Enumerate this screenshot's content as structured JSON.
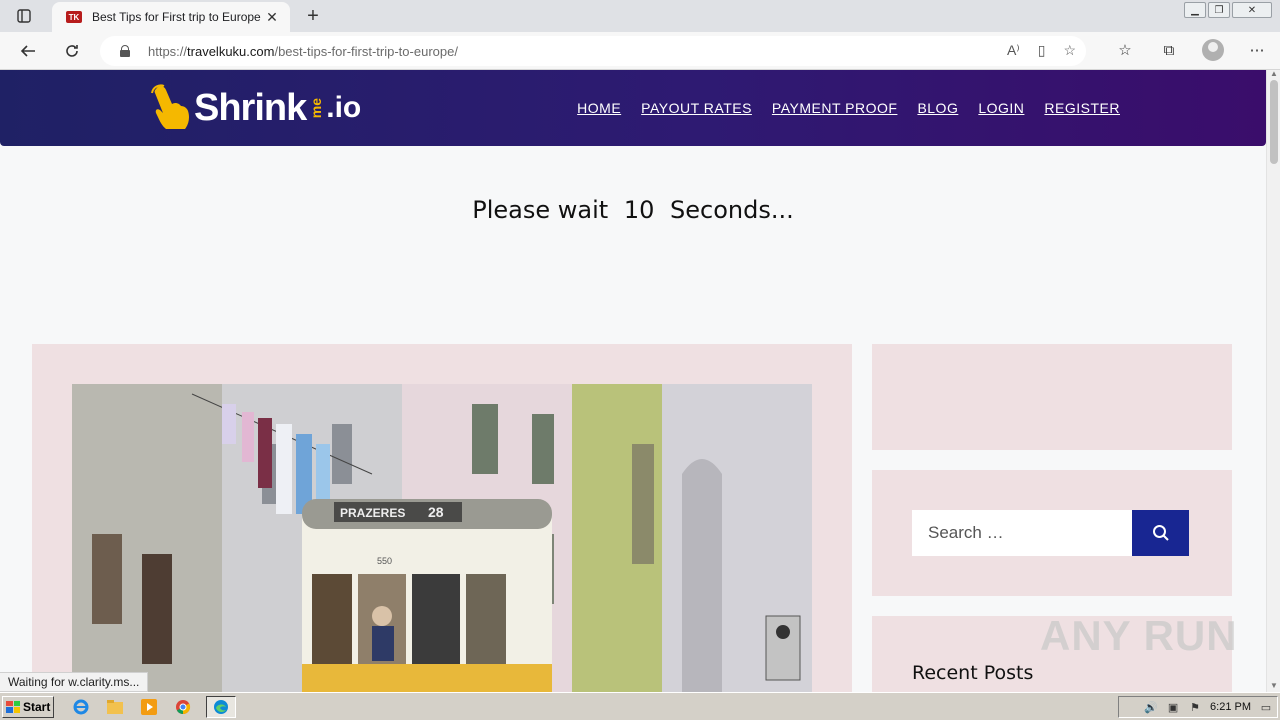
{
  "browser": {
    "tab_title": "Best Tips for First trip to Europe",
    "favicon_text": "TK",
    "url_scheme": "https://",
    "url_host": "travelkuku.com",
    "url_path": "/best-tips-for-first-trip-to-europe/",
    "status_text": "Waiting for w.clarity.ms..."
  },
  "site": {
    "logo_main": "Shrink",
    "logo_me": "me",
    "logo_io": ".io",
    "nav": [
      "HOME",
      "PAYOUT RATES",
      "PAYMENT PROOF",
      "BLOG",
      "LOGIN",
      "REGISTER"
    ],
    "wait_prefix": "Please wait",
    "wait_seconds": "10",
    "wait_suffix": "Seconds..."
  },
  "sidebar": {
    "search_placeholder": "Search …",
    "recent_posts_title": "Recent Posts"
  },
  "hero_image": {
    "tram_sign": "PRAZERES",
    "tram_route": "28",
    "tram_number": "550"
  },
  "watermark": "ANY RUN",
  "taskbar": {
    "start_label": "Start",
    "clock": "6:21 PM"
  },
  "colors": {
    "header_start": "#1f2165",
    "header_end": "#3a0d6b",
    "card_bg": "#efe0e2",
    "search_btn": "#182692",
    "logo_accent": "#f5b800"
  }
}
